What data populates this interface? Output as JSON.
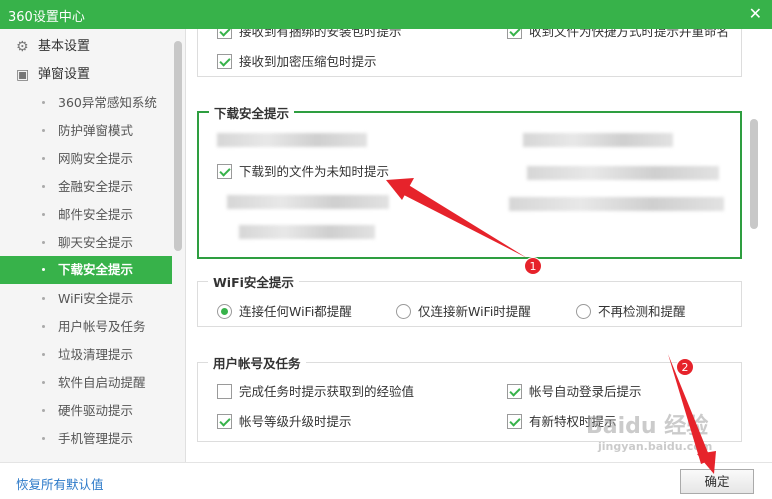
{
  "window": {
    "title": "360设置中心",
    "close_icon": "✕"
  },
  "sidebar": {
    "categories": [
      {
        "label": "基本设置",
        "icon": "gear-icon"
      },
      {
        "label": "弹窗设置",
        "icon": "window-icon"
      }
    ],
    "items": [
      {
        "label": "360异常感知系统",
        "active": false
      },
      {
        "label": "防护弹窗模式",
        "active": false
      },
      {
        "label": "网购安全提示",
        "active": false
      },
      {
        "label": "金融安全提示",
        "active": false
      },
      {
        "label": "邮件安全提示",
        "active": false
      },
      {
        "label": "聊天安全提示",
        "active": false
      },
      {
        "label": "下载安全提示",
        "active": true
      },
      {
        "label": "WiFi安全提示",
        "active": false
      },
      {
        "label": "用户帐号及任务",
        "active": false
      },
      {
        "label": "垃圾清理提示",
        "active": false
      },
      {
        "label": "软件自启动提醒",
        "active": false
      },
      {
        "label": "硬件驱动提示",
        "active": false
      },
      {
        "label": "手机管理提示",
        "active": false
      }
    ]
  },
  "top_section": {
    "row1_left": "接收到有捆绑的安装包时提示",
    "row1_right": "收到文件为快捷方式时提示并重命名",
    "row2_left": "接收到加密压缩包时提示"
  },
  "download_section": {
    "title": "下载安全提示",
    "checkbox_label": "下载到的文件为未知时提示",
    "checked": true
  },
  "wifi_section": {
    "title": "WiFi安全提示",
    "options": [
      {
        "label": "连接任何WiFi都提醒",
        "selected": true
      },
      {
        "label": "仅连接新WiFi时提醒",
        "selected": false
      },
      {
        "label": "不再检测和提醒",
        "selected": false
      }
    ]
  },
  "account_section": {
    "title": "用户帐号及任务",
    "items": [
      {
        "label": "完成任务时提示获取到的经验值",
        "checked": false
      },
      {
        "label": "帐号自动登录后提示",
        "checked": true
      },
      {
        "label": "帐号等级升级时提示",
        "checked": true
      },
      {
        "label": "有新特权时提示",
        "checked": true
      }
    ]
  },
  "footer": {
    "restore_label": "恢复所有默认值",
    "ok_label": "确定"
  },
  "annotations": {
    "badge1": "1",
    "badge2": "2",
    "arrow_color": "#e6232b"
  },
  "watermark": {
    "logo": "Baidu 经验",
    "url": "jingyan.baidu.com"
  },
  "colors": {
    "brand_green": "#37b24a",
    "highlight_border": "#2e9e40",
    "link_blue": "#2a78c8"
  }
}
